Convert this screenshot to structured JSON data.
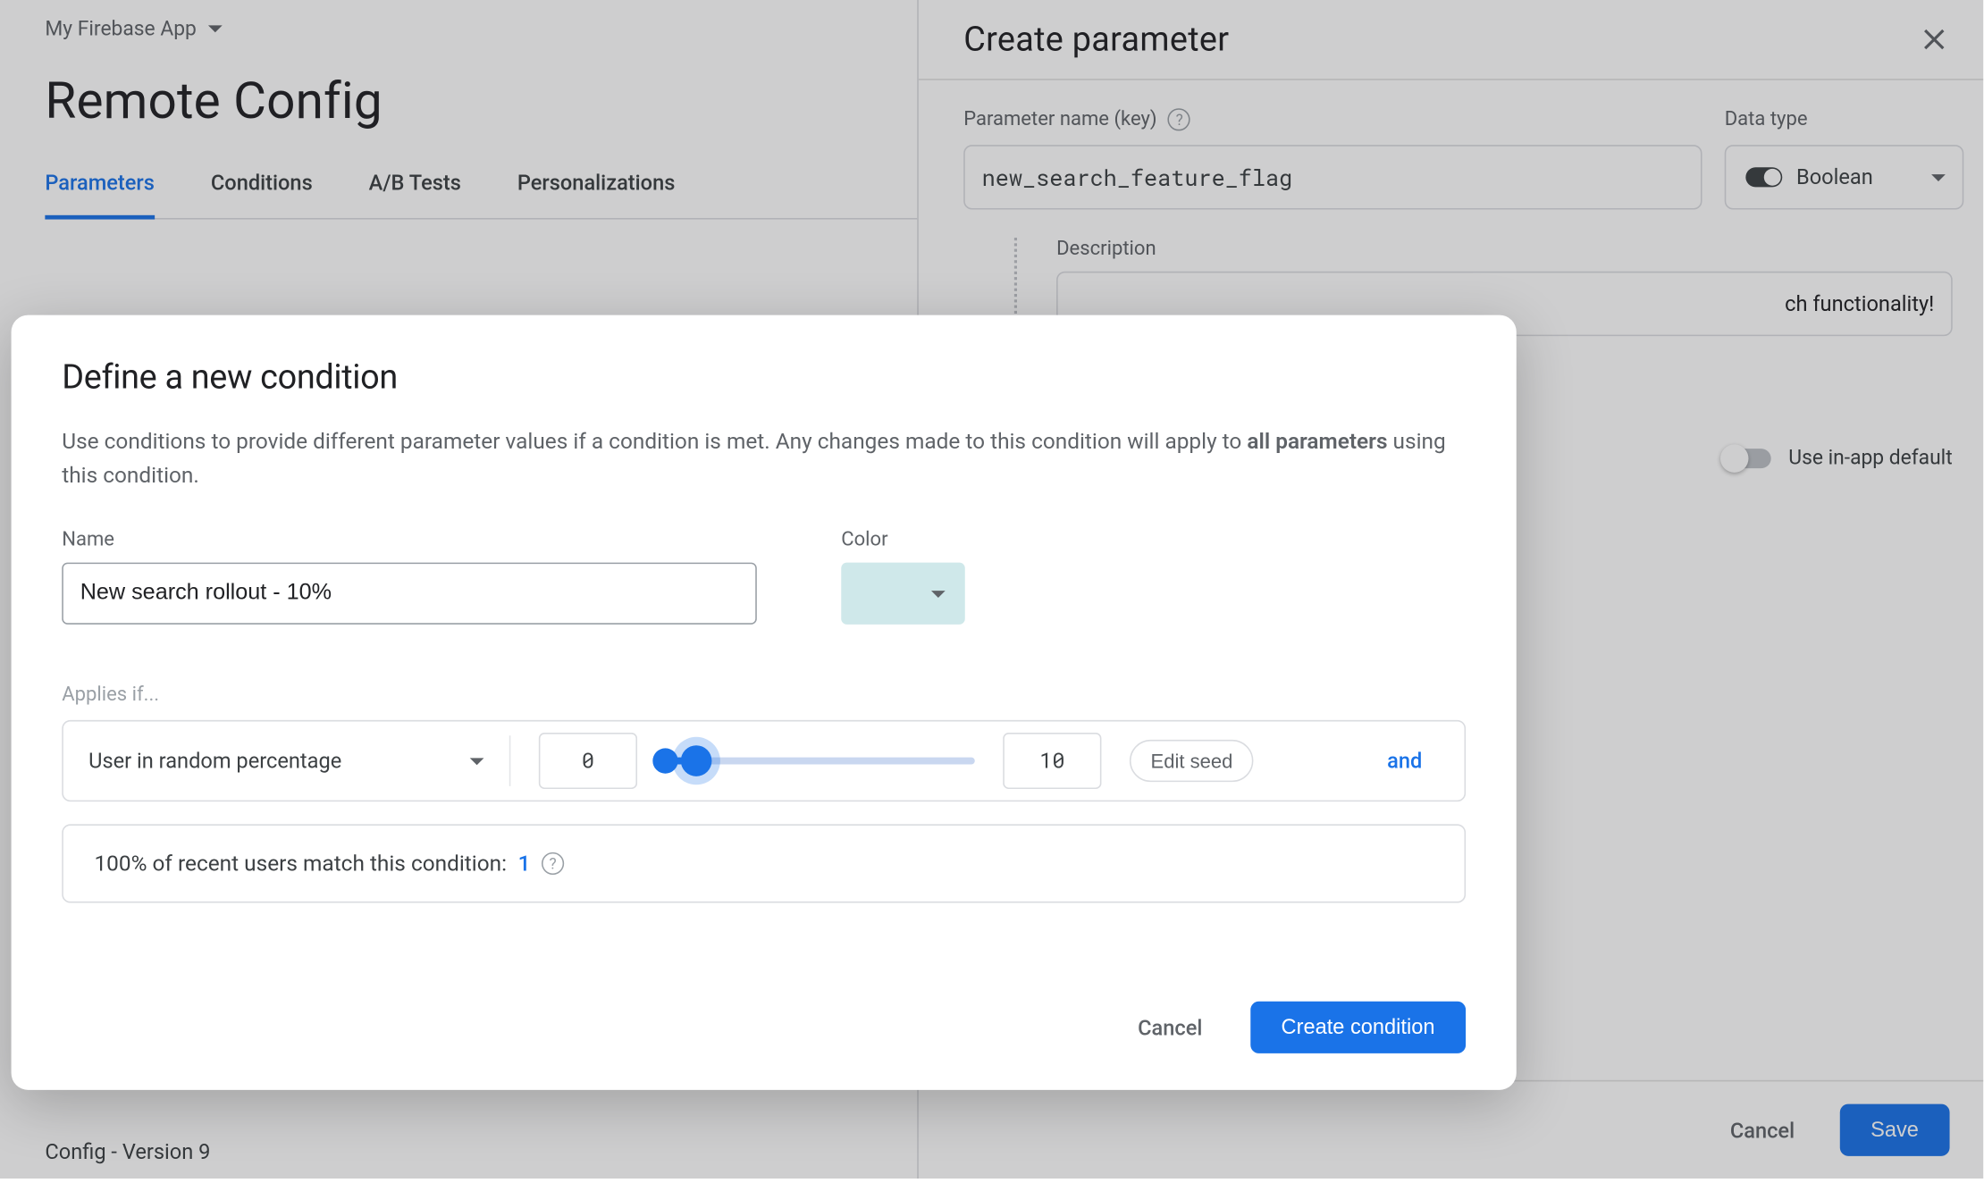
{
  "header": {
    "appName": "My Firebase App",
    "pageTitle": "Remote Config"
  },
  "tabs": {
    "parameters": "Parameters",
    "conditions": "Conditions",
    "abtests": "A/B Tests",
    "personalizations": "Personalizations"
  },
  "footer": {
    "version": "Config - Version 9"
  },
  "sidePanel": {
    "title": "Create parameter",
    "paramNameLabel": "Parameter name (key)",
    "paramNameValue": "new_search_feature_flag",
    "dataTypeLabel": "Data type",
    "dataTypeValue": "Boolean",
    "descLabel": "Description",
    "descValueVisible": "ch functionality!",
    "useInAppDefault": "Use in-app default",
    "cancel": "Cancel",
    "save": "Save"
  },
  "dialog": {
    "title": "Define a new condition",
    "introPart1": "Use conditions to provide different parameter values if a condition is met. Any changes made to this condition will apply to ",
    "introBold": "all parameters",
    "introPart2": " using this condition.",
    "nameLabel": "Name",
    "nameValue": "New search rollout - 10%",
    "colorLabel": "Color",
    "colorValue": "#cfe8ea",
    "appliesLabel": "Applies if...",
    "ruleSelect": "User in random percentage",
    "rangeLow": "0",
    "rangeHigh": "10",
    "editSeed": "Edit seed",
    "andLabel": "and",
    "matchText": "100% of recent users match this condition: ",
    "matchCount": "1",
    "cancel": "Cancel",
    "create": "Create condition"
  }
}
